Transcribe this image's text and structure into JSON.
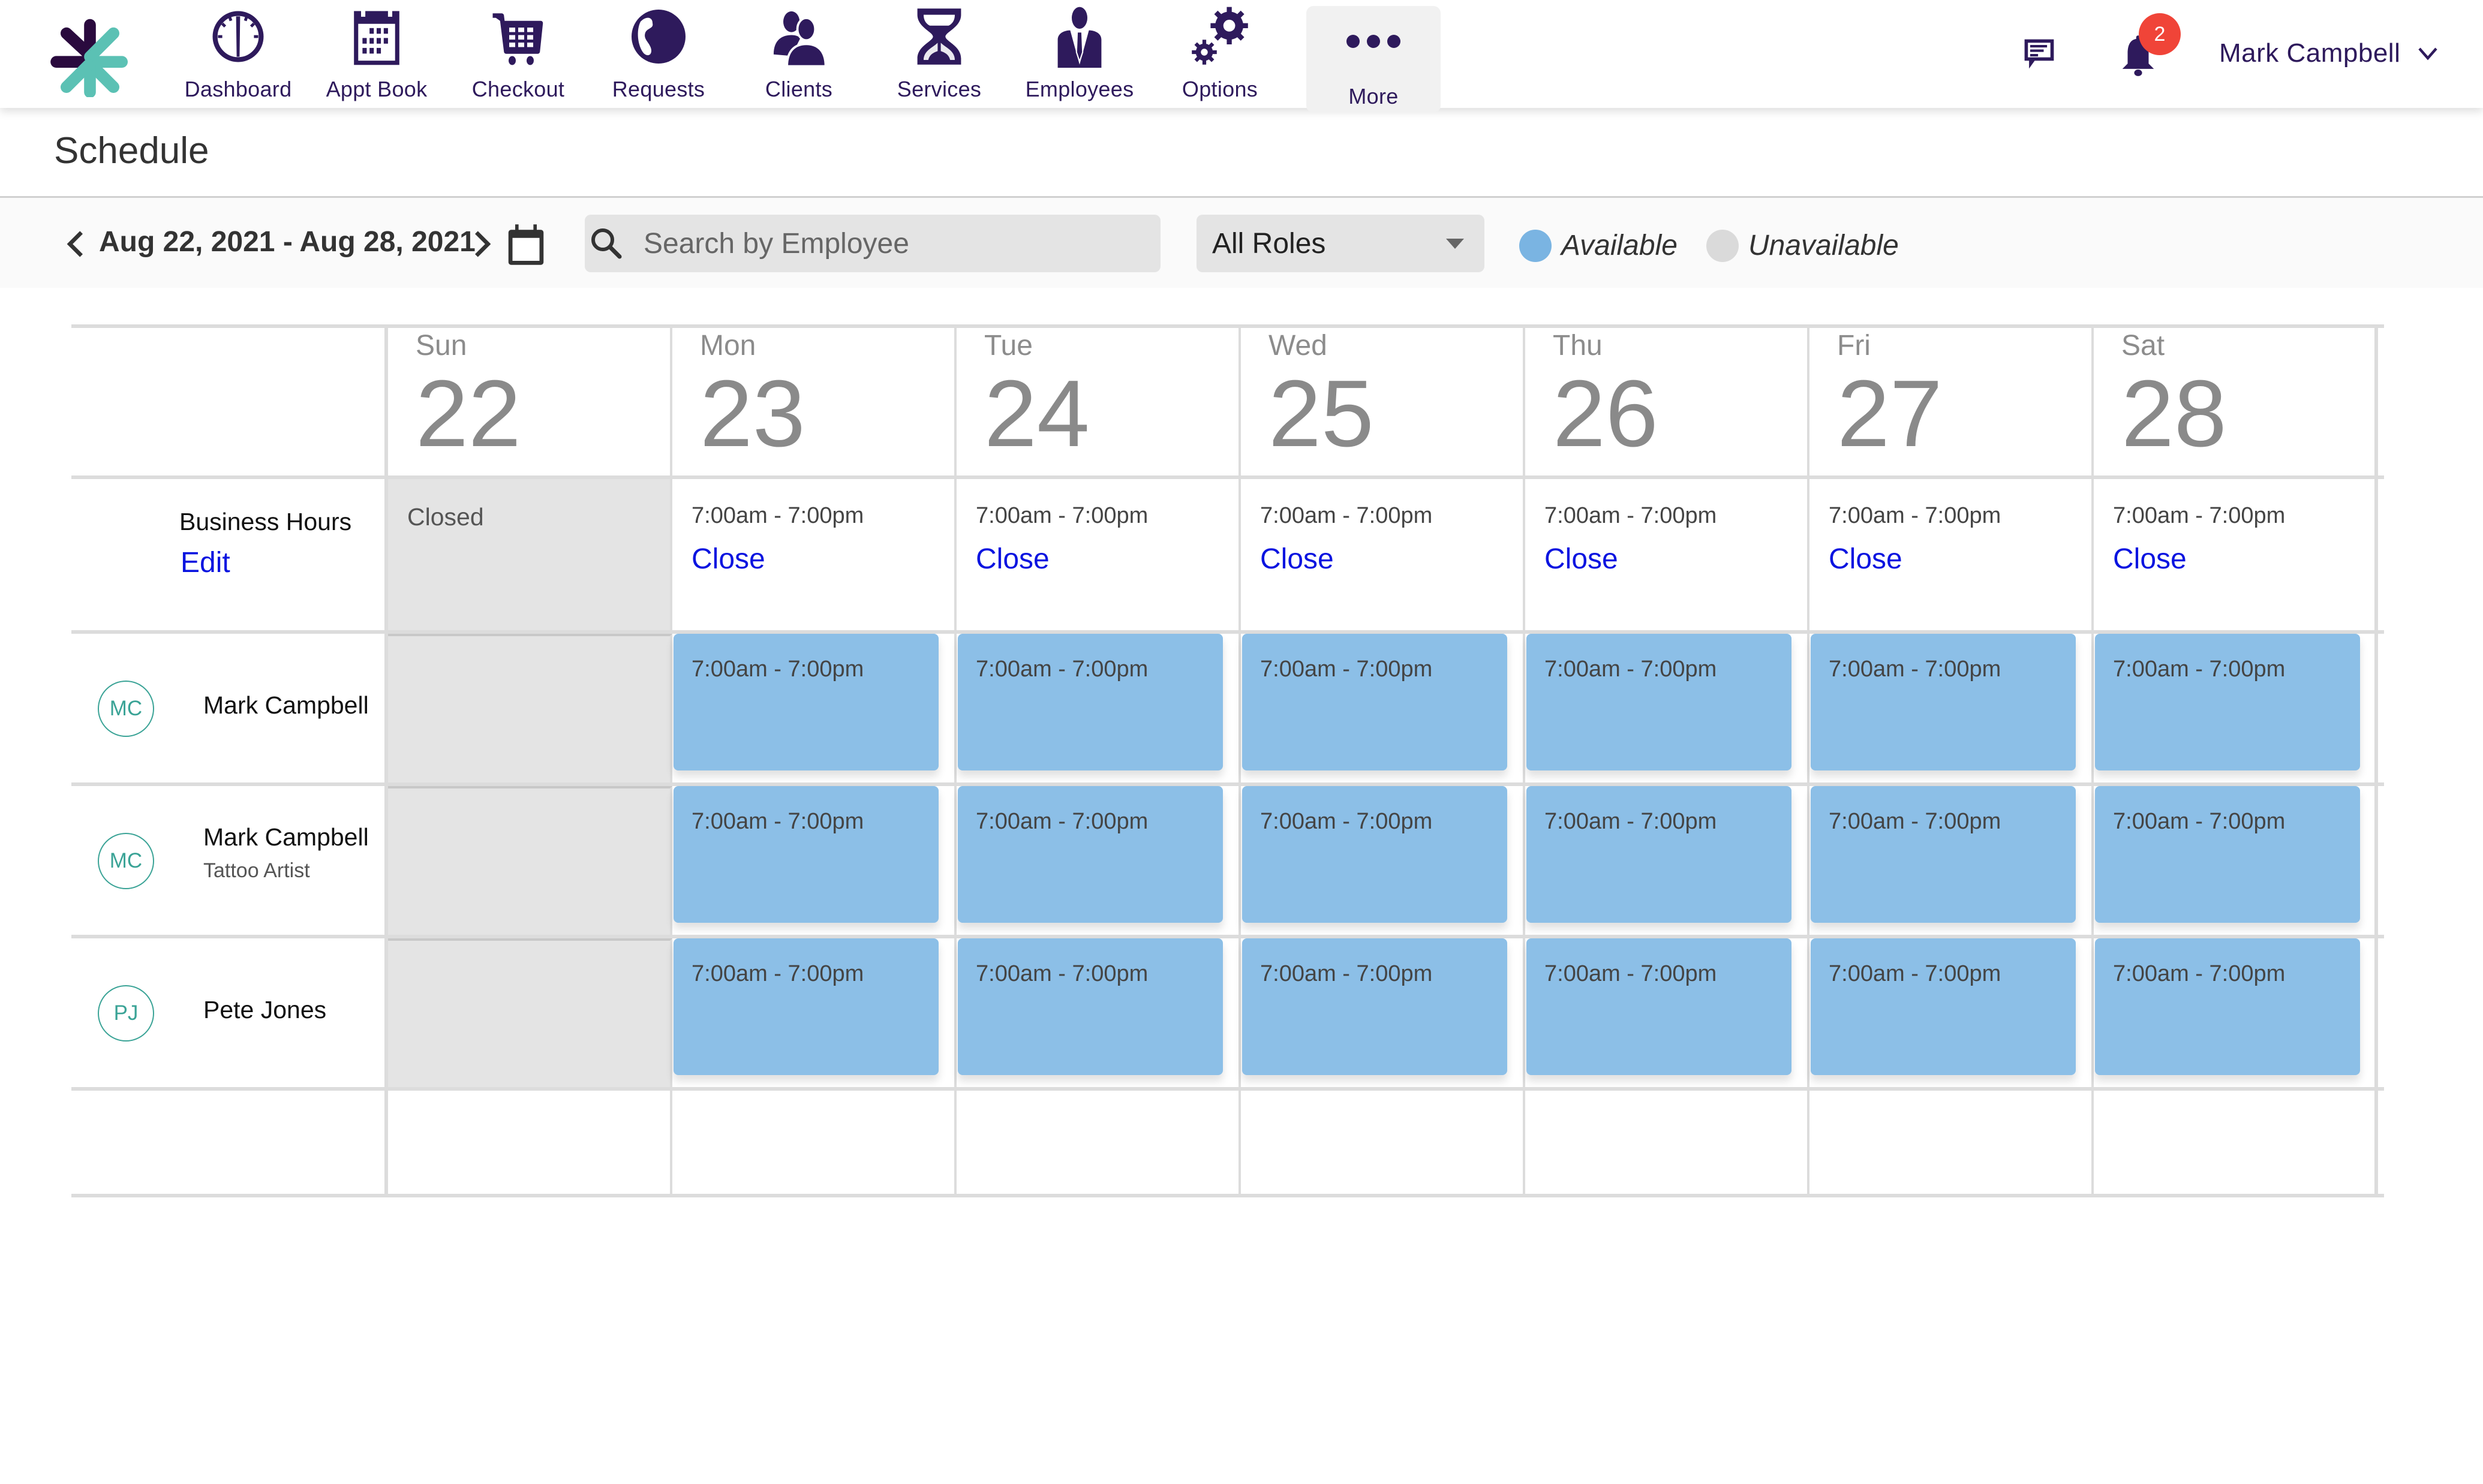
{
  "nav": {
    "items": [
      {
        "key": "dashboard",
        "label": "Dashboard",
        "icon": "dashboard-gauge-icon"
      },
      {
        "key": "appt-book",
        "label": "Appt Book",
        "icon": "calendar-icon"
      },
      {
        "key": "checkout",
        "label": "Checkout",
        "icon": "shopping-cart-icon"
      },
      {
        "key": "requests",
        "label": "Requests",
        "icon": "globe-icon"
      },
      {
        "key": "clients",
        "label": "Clients",
        "icon": "people-icon"
      },
      {
        "key": "services",
        "label": "Services",
        "icon": "hourglass-icon"
      },
      {
        "key": "employees",
        "label": "Employees",
        "icon": "employee-suit-icon"
      },
      {
        "key": "options",
        "label": "Options",
        "icon": "gears-icon"
      },
      {
        "key": "more",
        "label": "More",
        "icon": "ellipsis-icon"
      }
    ],
    "notifications_count": "2",
    "user_name": "Mark Campbell"
  },
  "page": {
    "title": "Schedule"
  },
  "toolbar": {
    "date_range": "Aug 22, 2021 - Aug 28, 2021",
    "search_placeholder": "Search by Employee",
    "search_value": "",
    "roles_selected": "All Roles",
    "legend": [
      {
        "label": "Available",
        "color": "#7ab4e2"
      },
      {
        "label": "Unavailable",
        "color": "#dadada"
      }
    ]
  },
  "schedule": {
    "days": [
      {
        "dow": "Sun",
        "date": "22"
      },
      {
        "dow": "Mon",
        "date": "23"
      },
      {
        "dow": "Tue",
        "date": "24"
      },
      {
        "dow": "Wed",
        "date": "25"
      },
      {
        "dow": "Thu",
        "date": "26"
      },
      {
        "dow": "Fri",
        "date": "27"
      },
      {
        "dow": "Sat",
        "date": "28"
      }
    ],
    "business_hours": {
      "label": "Business Hours",
      "edit_label": "Edit",
      "closed_label": "Closed",
      "close_label": "Close",
      "days": [
        {
          "closed": true,
          "hours": ""
        },
        {
          "closed": false,
          "hours": "7:00am - 7:00pm"
        },
        {
          "closed": false,
          "hours": "7:00am - 7:00pm"
        },
        {
          "closed": false,
          "hours": "7:00am - 7:00pm"
        },
        {
          "closed": false,
          "hours": "7:00am - 7:00pm"
        },
        {
          "closed": false,
          "hours": "7:00am - 7:00pm"
        },
        {
          "closed": false,
          "hours": "7:00am - 7:00pm"
        }
      ]
    },
    "employees": [
      {
        "initials": "MC",
        "name": "Mark Campbell",
        "role": "",
        "shifts": [
          "",
          "7:00am - 7:00pm",
          "7:00am - 7:00pm",
          "7:00am - 7:00pm",
          "7:00am - 7:00pm",
          "7:00am - 7:00pm",
          "7:00am - 7:00pm"
        ]
      },
      {
        "initials": "MC",
        "name": "Mark Campbell",
        "role": "Tattoo Artist",
        "shifts": [
          "",
          "7:00am - 7:00pm",
          "7:00am - 7:00pm",
          "7:00am - 7:00pm",
          "7:00am - 7:00pm",
          "7:00am - 7:00pm",
          "7:00am - 7:00pm"
        ]
      },
      {
        "initials": "PJ",
        "name": "Pete Jones",
        "role": "",
        "shifts": [
          "",
          "7:00am - 7:00pm",
          "7:00am - 7:00pm",
          "7:00am - 7:00pm",
          "7:00am - 7:00pm",
          "7:00am - 7:00pm",
          "7:00am - 7:00pm"
        ]
      }
    ]
  },
  "colors": {
    "brand_dark": "#2e1a5c",
    "brand_teal": "#5bc1b4",
    "link": "#0a14e0",
    "shift_available": "#8cbfe7",
    "closed_bg": "#e4e4e4",
    "badge": "#f04438"
  }
}
